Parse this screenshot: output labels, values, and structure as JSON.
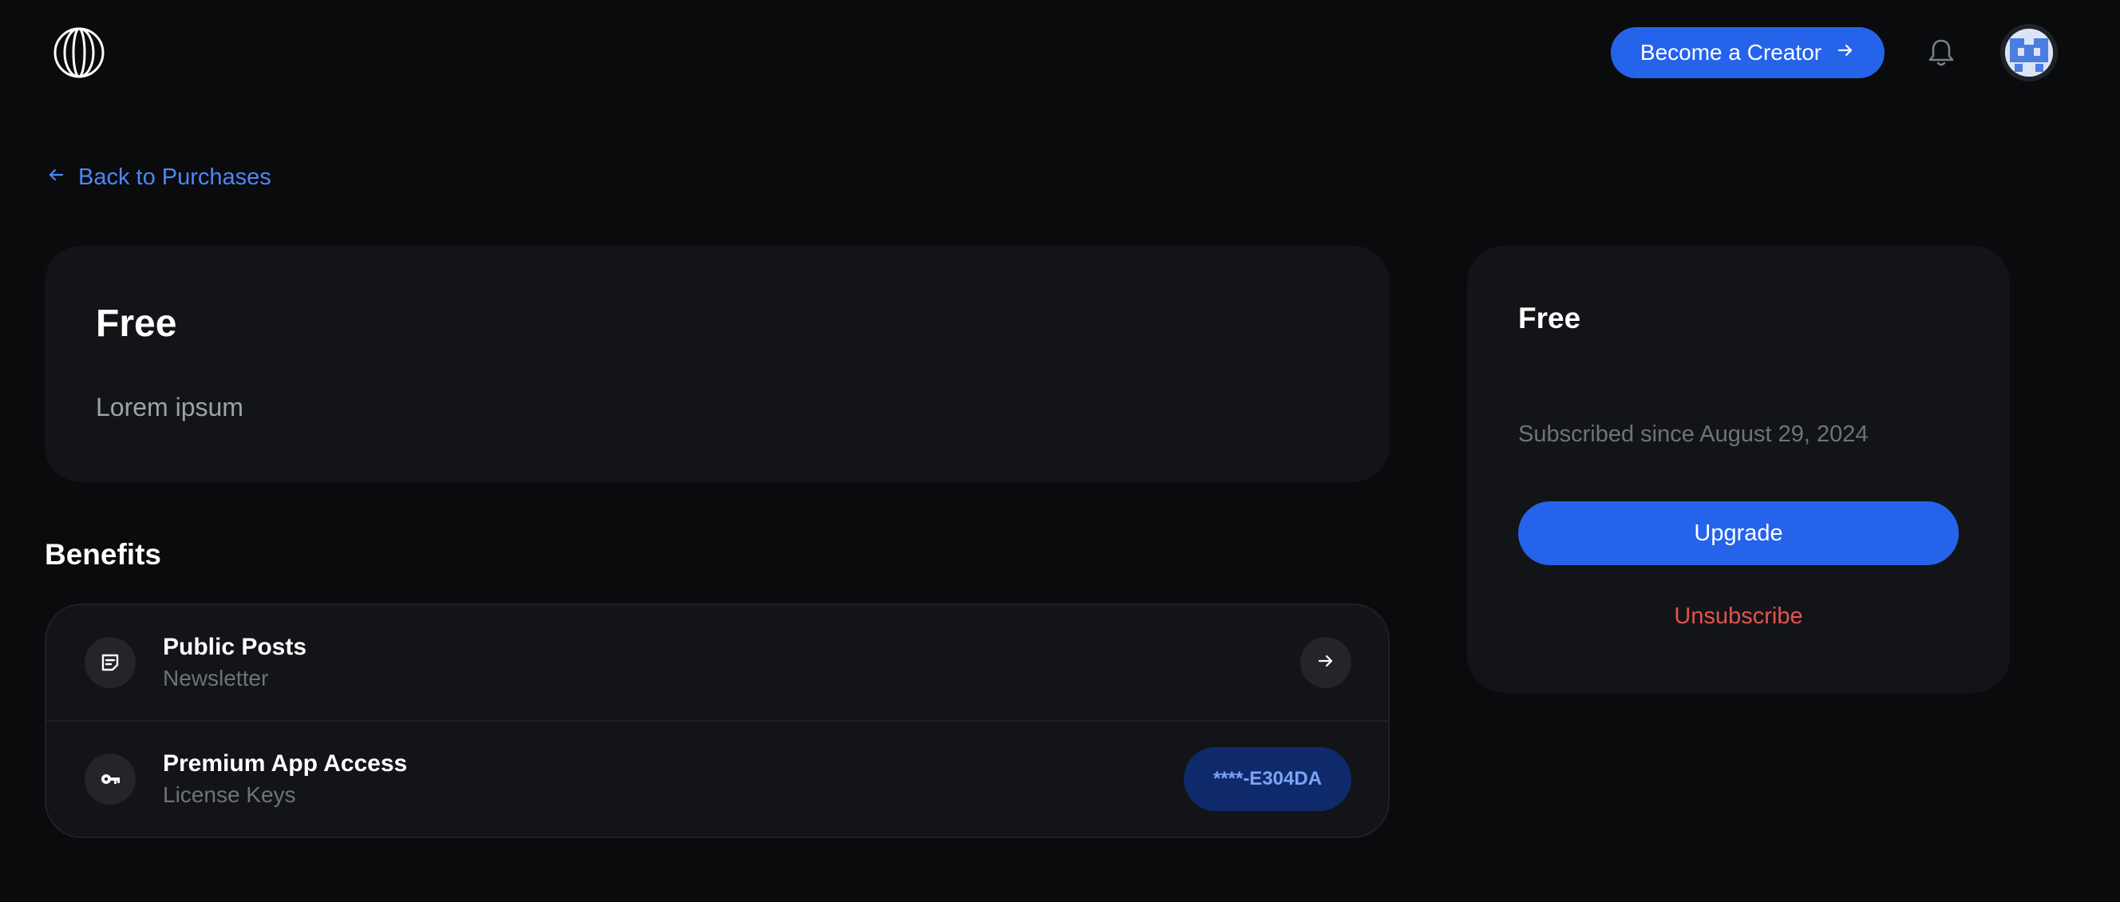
{
  "header": {
    "logo_icon": "polar-logo-icon",
    "become_creator_label": "Become a Creator",
    "notification_icon": "bell-icon",
    "avatar_icon": "avatar-icon"
  },
  "back_link": {
    "label": "Back to Purchases"
  },
  "product": {
    "title": "Free",
    "description": "Lorem ipsum"
  },
  "benefits": {
    "heading": "Benefits",
    "items": [
      {
        "title": "Public Posts",
        "subtitle": "Newsletter",
        "icon": "note-icon",
        "action": "arrow-right-icon"
      },
      {
        "title": "Premium App Access",
        "subtitle": "License Keys",
        "icon": "key-icon",
        "license_key": "****-E304DA"
      }
    ]
  },
  "subscription": {
    "title": "Free",
    "since": "Subscribed since August 29, 2024",
    "upgrade_label": "Upgrade",
    "unsubscribe_label": "Unsubscribe"
  },
  "colors": {
    "background": "#0a0b0d",
    "card": "#131418",
    "accent": "#2563eb",
    "link": "#4f86f7",
    "danger": "#e5534b"
  }
}
